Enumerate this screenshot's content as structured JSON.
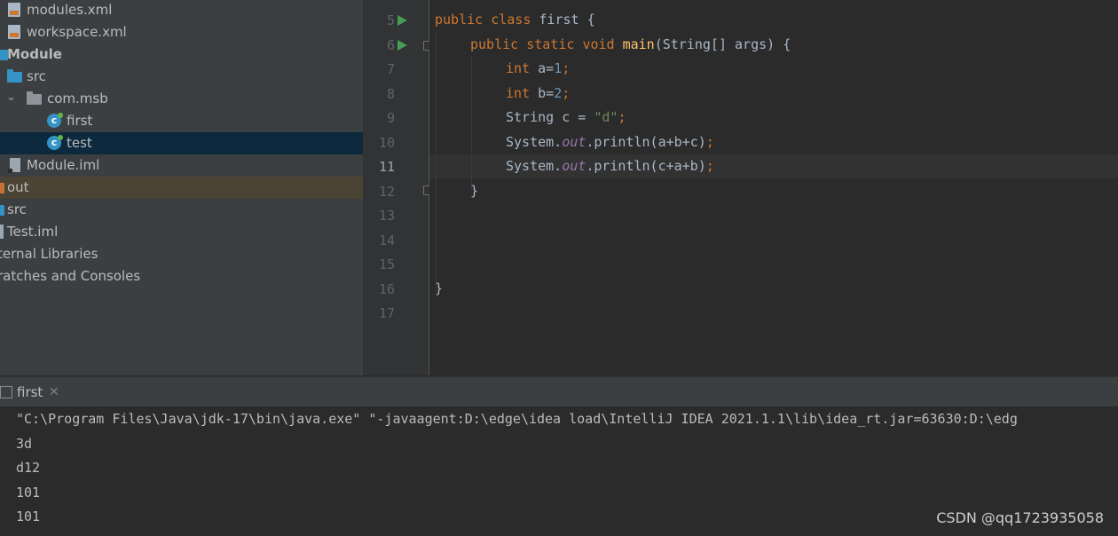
{
  "project_tree": {
    "items": [
      {
        "label": "modules.xml",
        "icon": "xml-file-icon"
      },
      {
        "label": "workspace.xml",
        "icon": "xml-file-icon"
      },
      {
        "label": "Module",
        "icon": "module-folder-icon"
      },
      {
        "label": "src",
        "icon": "source-folder-icon"
      },
      {
        "label": "com.msb",
        "icon": "package-icon"
      },
      {
        "label": "first",
        "icon": "java-class-icon"
      },
      {
        "label": "test",
        "icon": "java-class-icon"
      },
      {
        "label": "Module.iml",
        "icon": "iml-file-icon"
      },
      {
        "label": "out",
        "icon": "excluded-folder-icon"
      },
      {
        "label": "src",
        "icon": "source-folder-icon"
      },
      {
        "label": "Test.iml",
        "icon": "iml-file-icon"
      },
      {
        "label": "ternal Libraries",
        "icon": "libraries-icon"
      },
      {
        "label": "ratches and Consoles",
        "icon": "scratches-icon"
      }
    ]
  },
  "editor": {
    "active_line": "11",
    "line_numbers": [
      "5",
      "6",
      "7",
      "8",
      "9",
      "10",
      "11",
      "12",
      "13",
      "14",
      "15",
      "16",
      "17"
    ],
    "tokens": {
      "kw_public": "public",
      "kw_class": "class",
      "kw_static": "static",
      "kw_void": "void",
      "kw_int": "int",
      "class_name": "first",
      "brace_open": "{",
      "brace_close": "}",
      "method_name": "main",
      "main_params": "(String[] args) ",
      "var_a": "a=",
      "num_1": "1",
      "var_b": "b=",
      "num_2": "2",
      "semi": ";",
      "string_decl": "String c = ",
      "str_d": "\"d\"",
      "system": "System.",
      "out_field": "out",
      "println_abc": ".println(a+b+c)",
      "println_cab": ".println(c+a+b)"
    }
  },
  "run_panel": {
    "tab_label": "first",
    "close_glyph": "✕"
  },
  "console": {
    "lines": [
      "\"C:\\Program Files\\Java\\jdk-17\\bin\\java.exe\" \"-javaagent:D:\\edge\\idea load\\IntelliJ IDEA 2021.1.1\\lib\\idea_rt.jar=63630:D:\\edg",
      "3d",
      "d12",
      "101",
      "101"
    ]
  },
  "watermark": "CSDN @qq1723935058",
  "colors": {
    "keyword": "#cc7832",
    "number": "#6897bb",
    "string": "#6a8759",
    "static_field": "#9876aa",
    "method": "#ffc66d",
    "run_gutter": "#499c54",
    "selection": "#0d293e"
  }
}
